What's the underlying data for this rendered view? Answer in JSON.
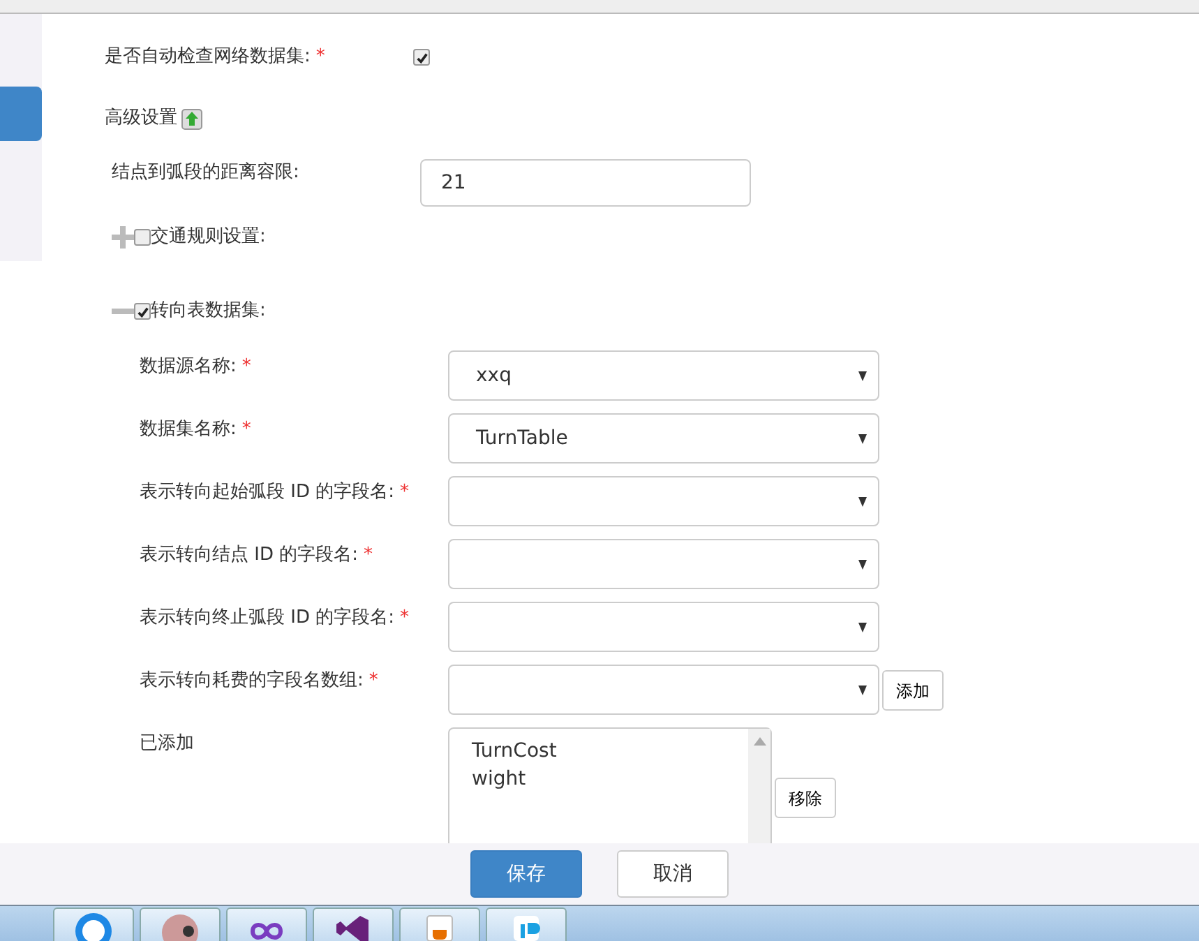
{
  "sidebar": {
    "items": [
      {
        "selected": true
      }
    ]
  },
  "auto_check": {
    "label": "是否自动检查网络数据集:",
    "required_mark": "*",
    "checked": true
  },
  "advanced": {
    "label": "高级设置",
    "expanded": true
  },
  "tolerance": {
    "label": "结点到弧段的距离容限:",
    "value": "21"
  },
  "sections": [
    {
      "label": "交通规则设置:",
      "expanded": false,
      "checked": false
    },
    {
      "label": "转向表数据集:",
      "expanded": true,
      "checked": true
    }
  ],
  "fields": [
    {
      "kind": "select",
      "label": "数据源名称:",
      "required_mark": "*",
      "value": "xxq"
    },
    {
      "kind": "select",
      "label": "数据集名称:",
      "required_mark": "*",
      "value": "TurnTable"
    },
    {
      "kind": "select",
      "label": "表示转向起始弧段 ID 的字段名:",
      "required_mark": "*"
    },
    {
      "kind": "select",
      "label": "表示转向结点 ID 的字段名:",
      "required_mark": "*"
    },
    {
      "kind": "select",
      "label": "表示转向终止弧段 ID 的字段名:",
      "required_mark": "*"
    },
    {
      "kind": "select",
      "label": "表示转向耗费的字段名数组:",
      "required_mark": "*",
      "button": "添加"
    },
    {
      "kind": "listbox",
      "label": "已添加",
      "items": [
        "TurnCost",
        "wight"
      ],
      "button": "移除"
    }
  ],
  "footer": {
    "buttons": [
      {
        "label": "保存",
        "primary": true
      },
      {
        "label": "取消",
        "primary": false
      }
    ]
  },
  "taskbar": {
    "apps": [
      {
        "kind": "search"
      },
      {
        "kind": "avatar"
      },
      {
        "kind": "infinity"
      },
      {
        "kind": "studio"
      },
      {
        "kind": "java"
      },
      {
        "kind": "ide"
      }
    ]
  }
}
